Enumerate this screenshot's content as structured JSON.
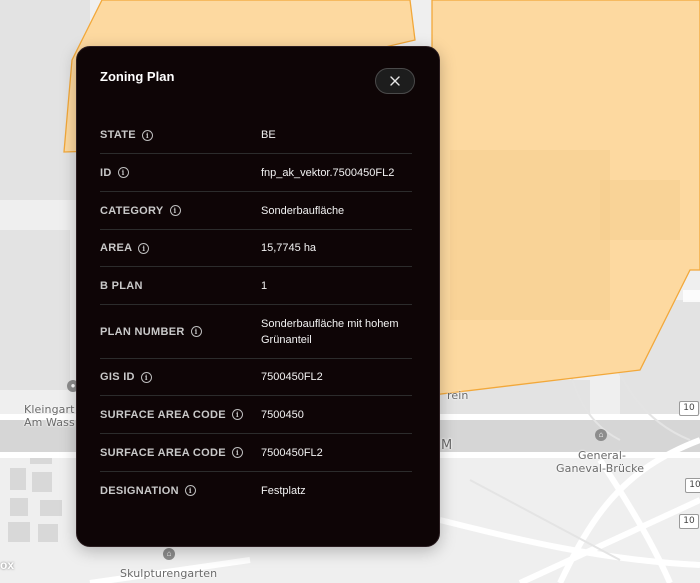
{
  "map": {
    "labels": {
      "kleingarten": "Kleingart",
      "am_wasser": "Am Wass",
      "general": "General-",
      "ganeval_bruecke": "Ganeval-Brücke",
      "skulpturengarten": "Skulpturengarten",
      "rein": "rein",
      "m": "M"
    },
    "shields": [
      "10",
      "10",
      "10"
    ],
    "attribution": "ox"
  },
  "panel": {
    "title": "Zoning Plan",
    "close_icon": "close-icon",
    "rows": [
      {
        "key": "STATE",
        "info": true,
        "value": "BE"
      },
      {
        "key": "ID",
        "info": true,
        "value": "fnp_ak_vektor.7500450FL2"
      },
      {
        "key": "CATEGORY",
        "info": true,
        "value": "Sonderbaufläche"
      },
      {
        "key": "AREA",
        "info": true,
        "value": "15,7745 ha"
      },
      {
        "key": "B PLAN",
        "info": false,
        "value": "1"
      },
      {
        "key": "PLAN NUMBER",
        "info": true,
        "value": "Sonderbaufläche mit hohem Grünanteil"
      },
      {
        "key": "GIS ID",
        "info": true,
        "value": "7500450FL2"
      },
      {
        "key": "SURFACE AREA CODE",
        "info": true,
        "value": "7500450"
      },
      {
        "key": "SURFACE AREA CODE",
        "info": true,
        "value": "7500450FL2"
      },
      {
        "key": "DESIGNATION",
        "info": true,
        "value": "Festplatz"
      }
    ]
  },
  "colors": {
    "zone_fill": "#fdd9a0",
    "zone_stroke": "#f2a83a",
    "panel_bg": "#0e0506"
  }
}
